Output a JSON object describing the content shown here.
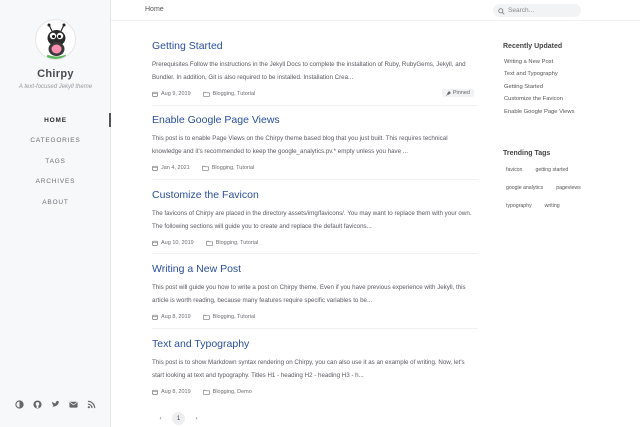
{
  "sidebar": {
    "site_title": "Chirpy",
    "site_subtitle": "A text-focused Jekyll theme",
    "nav": [
      {
        "label": "HOME",
        "active": true
      },
      {
        "label": "CATEGORIES",
        "active": false
      },
      {
        "label": "TAGS",
        "active": false
      },
      {
        "label": "ARCHIVES",
        "active": false
      },
      {
        "label": "ABOUT",
        "active": false
      }
    ],
    "bottom_icons": [
      "theme-toggle-icon",
      "github-icon",
      "twitter-icon",
      "email-icon",
      "rss-icon"
    ]
  },
  "topbar": {
    "breadcrumb": "Home",
    "search_placeholder": "Search..."
  },
  "posts": [
    {
      "title": "Getting Started",
      "excerpt": "Prerequisites Follow the instructions in the Jekyll Docs to complete the installation of Ruby, RubyGems, Jekyll, and Bundler. In addition, Git is also required to be installed. Installation Crea...",
      "date": "Aug 9, 2019",
      "categories": "Blogging, Tutorial",
      "pinned": "Pinned"
    },
    {
      "title": "Enable Google Page Views",
      "excerpt": "This post is to enable Page Views on the Chirpy theme based blog that you just built. This requires technical knowledge and it's recommended to keep the google_analytics.pv.* empty unless you have ...",
      "date": "Jan 4, 2021",
      "categories": "Blogging, Tutorial"
    },
    {
      "title": "Customize the Favicon",
      "excerpt": "The favicons of Chirpy are placed in the directory assets/img/favicons/. You may want to replace them with your own. The following sections will guide you to create and replace the default favicons...",
      "date": "Aug 10, 2019",
      "categories": "Blogging, Tutorial"
    },
    {
      "title": "Writing a New Post",
      "excerpt": "This post will guide you how to write a post on Chirpy theme. Even if you have previous experience with Jekyll, this article is worth reading, because many features require specific variables to be...",
      "date": "Aug 8, 2019",
      "categories": "Blogging, Tutorial"
    },
    {
      "title": "Text and Typography",
      "excerpt": "This post is to show Markdown syntax rendering on Chirpy, you can also use it as an example of writing. Now, let's start looking at text and typography. Titles H1 - heading H2 - heading H3 - h...",
      "date": "Aug 8, 2019",
      "categories": "Blogging, Demo"
    }
  ],
  "pagination": {
    "prev": "‹",
    "current": "1",
    "next": "›"
  },
  "panel": {
    "recent_heading": "Recently Updated",
    "recent": [
      "Writing a New Post",
      "Text and Typography",
      "Getting Started",
      "Customize the Favicon",
      "Enable Google Page Views"
    ],
    "tags_heading": "Trending Tags",
    "tags": [
      "favicon",
      "getting started",
      "google analytics",
      "pageviews",
      "typography",
      "writing"
    ]
  },
  "colors": {
    "accent_link": "#2a4f9d",
    "sidebar_bg": "#f6f8fa"
  }
}
